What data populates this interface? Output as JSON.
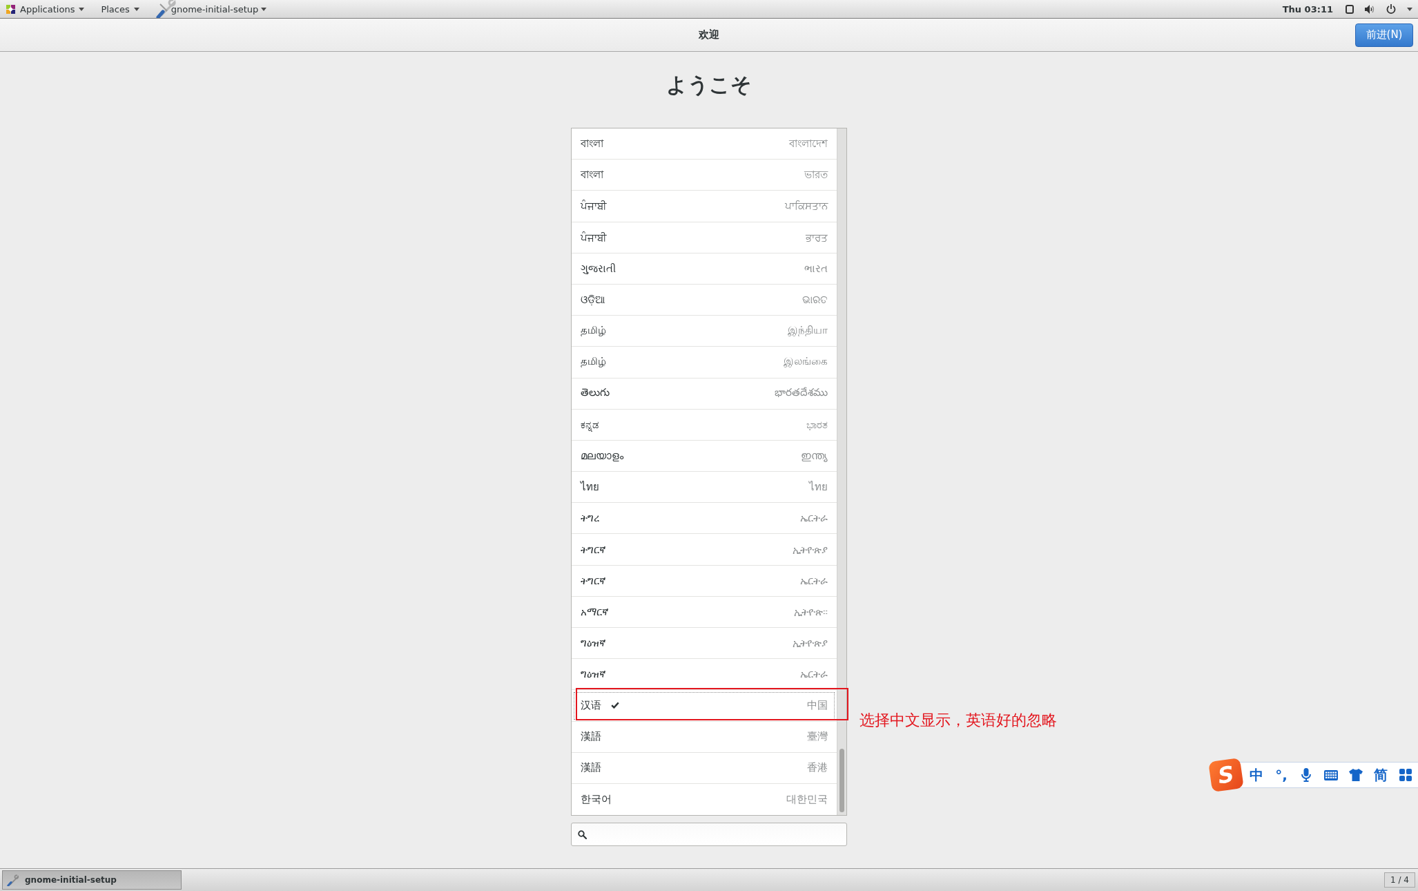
{
  "top_panel": {
    "applications_menu": "Applications",
    "places_menu": "Places",
    "app_menu": "gnome-initial-setup",
    "clock": "Thu 03:11"
  },
  "header_bar": {
    "title": "欢迎",
    "next_button": "前进(N)"
  },
  "heading": "ようこそ",
  "language_list": {
    "rows": [
      {
        "language": "বাংলা",
        "region": "বাংলাদেশ",
        "selected": false
      },
      {
        "language": "বাংলা",
        "region": "ভারত",
        "selected": false
      },
      {
        "language": "ਪੰਜਾਬੀ",
        "region": "ਪਾਕਿਸਤਾਨ",
        "selected": false
      },
      {
        "language": "ਪੰਜਾਬੀ",
        "region": "ਭਾਰਤ",
        "selected": false
      },
      {
        "language": "ગુજરાતી",
        "region": "ભારત",
        "selected": false
      },
      {
        "language": "ଓଡ଼ିଆ",
        "region": "ଭାରତ",
        "selected": false
      },
      {
        "language": "தமிழ்",
        "region": "இந்தியா",
        "selected": false
      },
      {
        "language": "தமிழ்",
        "region": "இலங்கை",
        "selected": false
      },
      {
        "language": "తెలుగు",
        "region": "భారతదేశము",
        "selected": false
      },
      {
        "language": "ಕನ್ನಡ",
        "region": "ಭಾರತ",
        "selected": false
      },
      {
        "language": "മലയാളം",
        "region": "ഇന്ത്യ",
        "selected": false
      },
      {
        "language": "ไทย",
        "region": "ไทย",
        "selected": false
      },
      {
        "language": "ትግረ",
        "region": "ኤርትራ",
        "selected": false
      },
      {
        "language": "ትግርኛ",
        "region": "ኢትዮጵያ",
        "selected": false
      },
      {
        "language": "ትግርኛ",
        "region": "ኤርትራ",
        "selected": false
      },
      {
        "language": "አማርኛ",
        "region": "ኢትዮጵ።",
        "selected": false
      },
      {
        "language": "ግዕዝኛ",
        "region": "ኢትዮጵያ",
        "selected": false
      },
      {
        "language": "ግዕዝኛ",
        "region": "ኤርትራ",
        "selected": false
      },
      {
        "language": "汉语",
        "region": "中国",
        "selected": true
      },
      {
        "language": "漢語",
        "region": "臺灣",
        "selected": false
      },
      {
        "language": "漢語",
        "region": "香港",
        "selected": false
      },
      {
        "language": "한국어",
        "region": "대한민국",
        "selected": false
      }
    ]
  },
  "annotation": {
    "text": "选择中文显示，英语好的忽略"
  },
  "ime_toolbar": {
    "logo": "S",
    "input_mode": "中",
    "punctuation": "°,",
    "charset": "简"
  },
  "taskbar": {
    "tasks": [
      {
        "label": "gnome-initial-setup",
        "selected": true
      }
    ],
    "workspace": "1 / 4"
  }
}
